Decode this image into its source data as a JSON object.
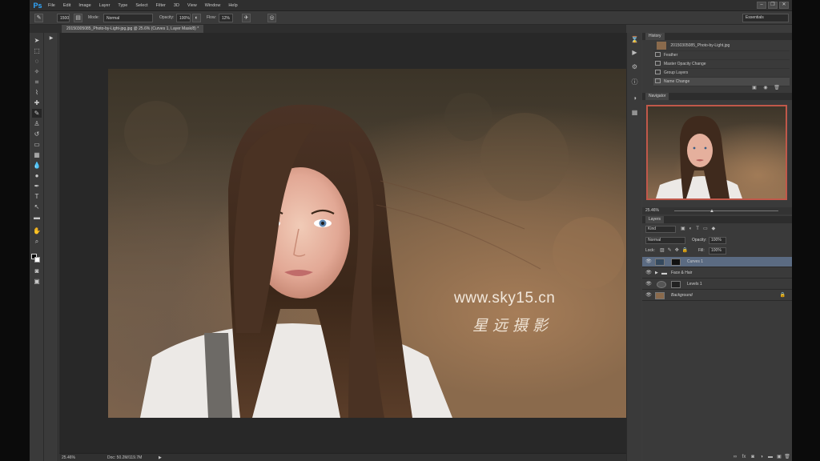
{
  "menu": {
    "logo": "Ps",
    "items": [
      "File",
      "Edit",
      "Image",
      "Layer",
      "Type",
      "Select",
      "Filter",
      "3D",
      "View",
      "Window",
      "Help"
    ],
    "window_controls": [
      "–",
      "❐",
      "✕"
    ]
  },
  "options": {
    "brush_size": "1500",
    "mode_label": "Mode:",
    "mode_value": "Normal",
    "opacity_label": "Opacity:",
    "opacity_value": "100%",
    "flow_label": "Flow:",
    "flow_value": "12%",
    "workspace": "Essentials"
  },
  "document": {
    "tab_title": "20150305085_Photo-by-Light-jpg.jpg @ 25.6% (Curves 1, Layer Mask/8) *",
    "zoom": "25.46%",
    "doc_size": "Doc: 50.2M/119.7M"
  },
  "watermark": {
    "url": "www.sky15.cn",
    "cn": "星远摄影"
  },
  "history": {
    "title": "History",
    "snapshot": "20150305085_Photo-by-Light.jpg",
    "items": [
      "Feather",
      "Master Opacity Change",
      "Group Layers",
      "Name Change"
    ]
  },
  "navigator": {
    "title": "Navigator",
    "zoom": "25.46%"
  },
  "layers": {
    "title": "Layers",
    "kind_label": "Kind",
    "blend_mode": "Normal",
    "opacity_label": "Opacity:",
    "opacity_value": "100%",
    "lock_label": "Lock:",
    "fill_label": "Fill:",
    "fill_value": "100%",
    "rows": [
      {
        "name": "Curves 1",
        "selected": true
      },
      {
        "name": "Face & Hair",
        "selected": false
      },
      {
        "name": "Levels 1",
        "selected": false
      },
      {
        "name": "Background",
        "selected": false
      }
    ]
  },
  "colors": {
    "accent_selected": "#5b6b82",
    "nav_frame": "#c0584a",
    "ps_blue": "#31a8ff"
  }
}
